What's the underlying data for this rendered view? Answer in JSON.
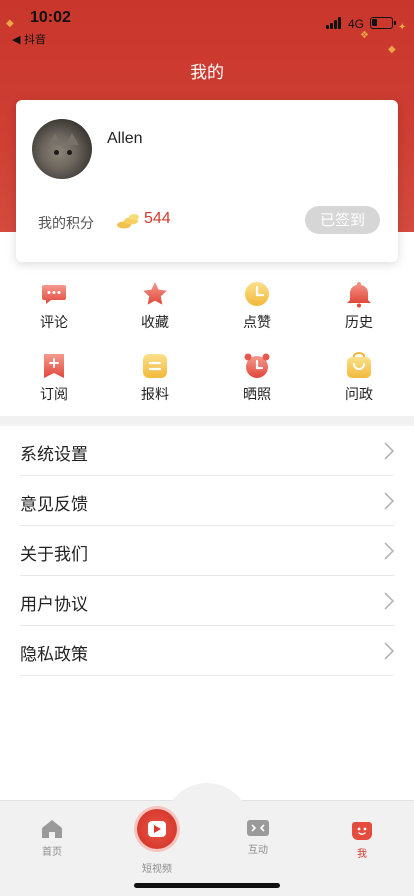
{
  "status_bar": {
    "time": "10:02",
    "back_app": "◀ 抖音",
    "network": "4G"
  },
  "page": {
    "title": "我的"
  },
  "profile": {
    "username": "Allen",
    "points_label": "我的积分",
    "points_value": "544",
    "checkin_label": "已签到"
  },
  "grid": [
    {
      "label": "评论",
      "icon": "comment-icon"
    },
    {
      "label": "收藏",
      "icon": "star-icon"
    },
    {
      "label": "点赞",
      "icon": "clock-icon"
    },
    {
      "label": "历史",
      "icon": "bell-icon"
    },
    {
      "label": "订阅",
      "icon": "subscribe-icon"
    },
    {
      "label": "报料",
      "icon": "report-icon"
    },
    {
      "label": "晒照",
      "icon": "alarm-icon"
    },
    {
      "label": "问政",
      "icon": "bag-icon"
    }
  ],
  "menu": [
    {
      "label": "系统设置"
    },
    {
      "label": "意见反馈"
    },
    {
      "label": "关于我们"
    },
    {
      "label": "用户协议"
    },
    {
      "label": "隐私政策"
    }
  ],
  "tabs": [
    {
      "label": "首页",
      "icon": "home-icon"
    },
    {
      "label": "短视频",
      "icon": "play-icon"
    },
    {
      "label": "互动",
      "icon": "interact-icon"
    },
    {
      "label": "我",
      "icon": "face-icon"
    }
  ],
  "colors": {
    "brand_red": "#d23a2e",
    "header_red": "#c9362c",
    "icon_gradient_top": "#f08a7e",
    "icon_gradient_bottom": "#e0493c",
    "gold": "#f2c14e"
  }
}
